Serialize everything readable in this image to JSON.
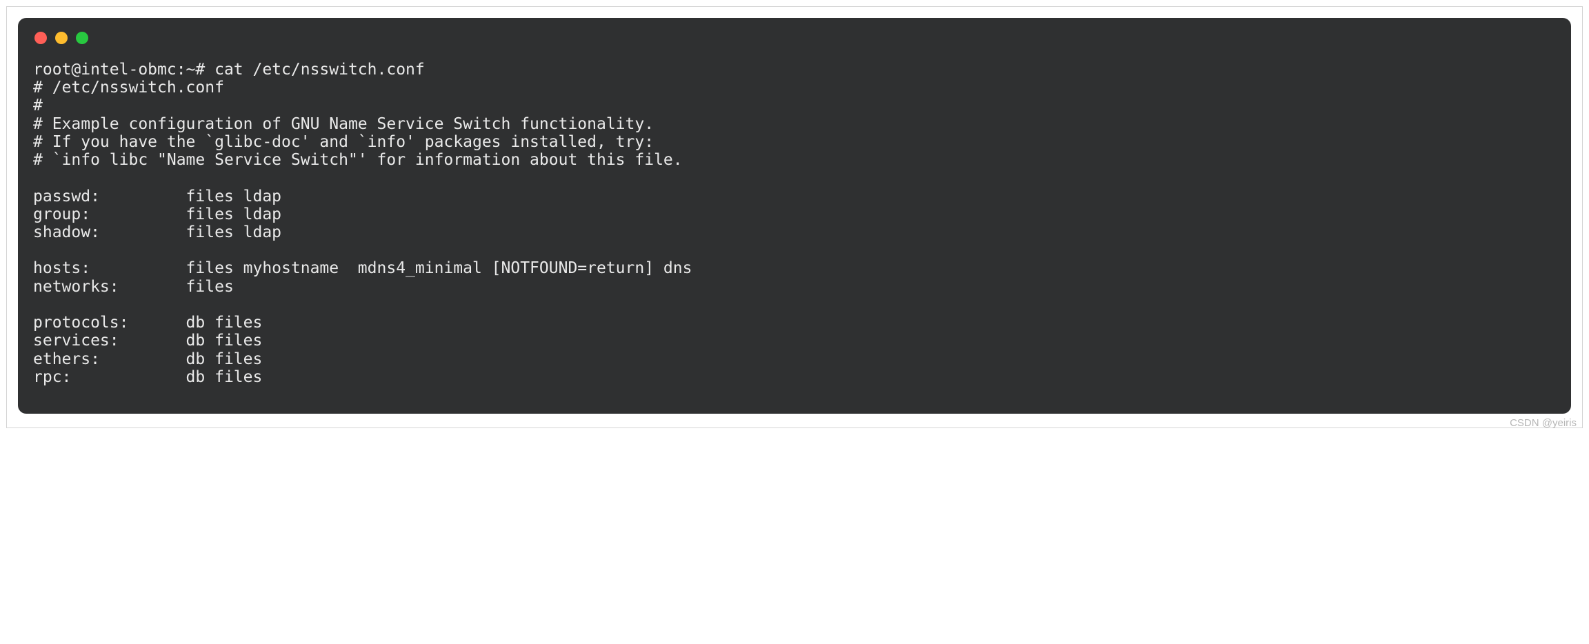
{
  "terminal": {
    "prompt": "root@intel-obmc:~# cat /etc/nsswitch.conf",
    "lines": {
      "l01": "# /etc/nsswitch.conf",
      "l02": "#",
      "l03": "# Example configuration of GNU Name Service Switch functionality.",
      "l04": "# If you have the `glibc-doc' and `info' packages installed, try:",
      "l05": "# `info libc \"Name Service Switch\"' for information about this file.",
      "l06": "",
      "l07": "passwd:         files ldap",
      "l08": "group:          files ldap",
      "l09": "shadow:         files ldap",
      "l10": "",
      "l11": "hosts:          files myhostname  mdns4_minimal [NOTFOUND=return] dns",
      "l12": "networks:       files",
      "l13": "",
      "l14": "protocols:      db files",
      "l15": "services:       db files",
      "l16": "ethers:         db files",
      "l17": "rpc:            db files"
    }
  },
  "watermark": "CSDN @yeiris"
}
